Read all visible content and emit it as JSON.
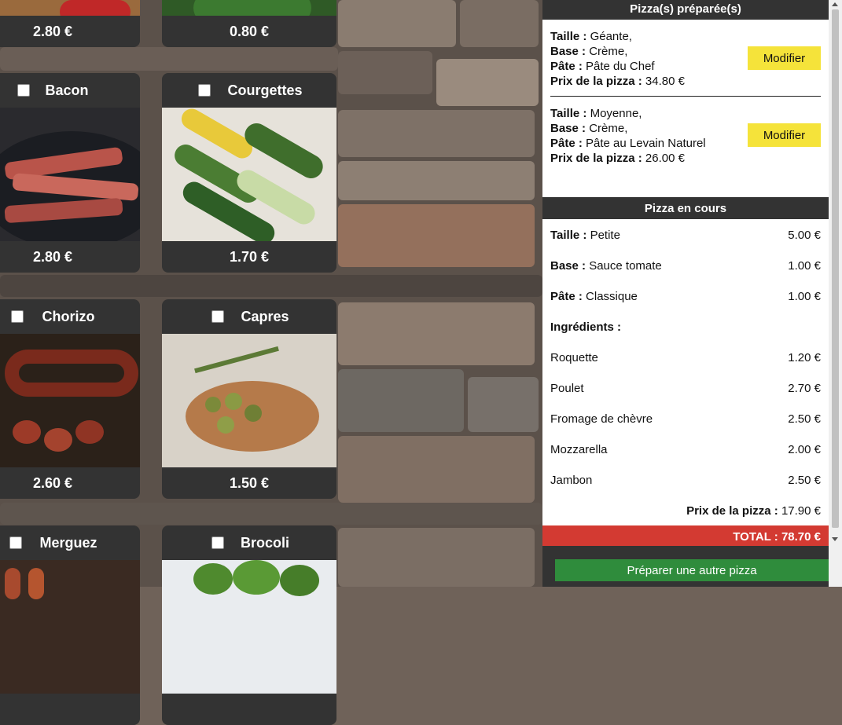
{
  "ingredients": [
    {
      "name": "",
      "price": "2.80 €"
    },
    {
      "name": "",
      "price": "0.80 €"
    },
    {
      "name": "Bacon",
      "price": "2.80 €"
    },
    {
      "name": "Courgettes",
      "price": "1.70 €"
    },
    {
      "name": "Chorizo",
      "price": "2.60 €"
    },
    {
      "name": "Capres",
      "price": "1.50 €"
    },
    {
      "name": "Merguez",
      "price": ""
    },
    {
      "name": "Brocoli",
      "price": ""
    }
  ],
  "prepared": {
    "title": "Pizza(s) préparée(s)",
    "pizzas": [
      {
        "taille_label": "Taille :",
        "taille": "Géante,",
        "base_label": "Base :",
        "base": "Crème,",
        "pate_label": "Pâte :",
        "pate": "Pâte du Chef",
        "prix_label": "Prix de la pizza :",
        "prix": "34.80 €",
        "button": "Modifier"
      },
      {
        "taille_label": "Taille :",
        "taille": "Moyenne,",
        "base_label": "Base :",
        "base": "Crème,",
        "pate_label": "Pâte :",
        "pate": "Pâte au Levain Naturel",
        "prix_label": "Prix de la pizza :",
        "prix": "26.00 €",
        "button": "Modifier"
      }
    ]
  },
  "current": {
    "title": "Pizza en cours",
    "taille_label": "Taille :",
    "taille": "Petite",
    "taille_price": "5.00 €",
    "base_label": "Base :",
    "base": "Sauce tomate",
    "base_price": "1.00 €",
    "pate_label": "Pâte :",
    "pate": "Classique",
    "pate_price": "1.00 €",
    "ingredients_label": "Ingrédients :",
    "ingredients": [
      {
        "name": "Roquette",
        "price": "1.20 €"
      },
      {
        "name": "Poulet",
        "price": "2.70 €"
      },
      {
        "name": "Fromage de chèvre",
        "price": "2.50 €"
      },
      {
        "name": "Mozzarella",
        "price": "2.00 €"
      },
      {
        "name": "Jambon",
        "price": "2.50 €"
      }
    ],
    "prix_label": "Prix de la pizza :",
    "prix": "17.90 €"
  },
  "total": "TOTAL : 78.70 €",
  "prepare_button": "Préparer une autre pizza",
  "colors": {
    "accent_yellow": "#f5e33a",
    "total_red": "#d33a32",
    "green": "#2f8c3c",
    "dark": "#333333"
  }
}
